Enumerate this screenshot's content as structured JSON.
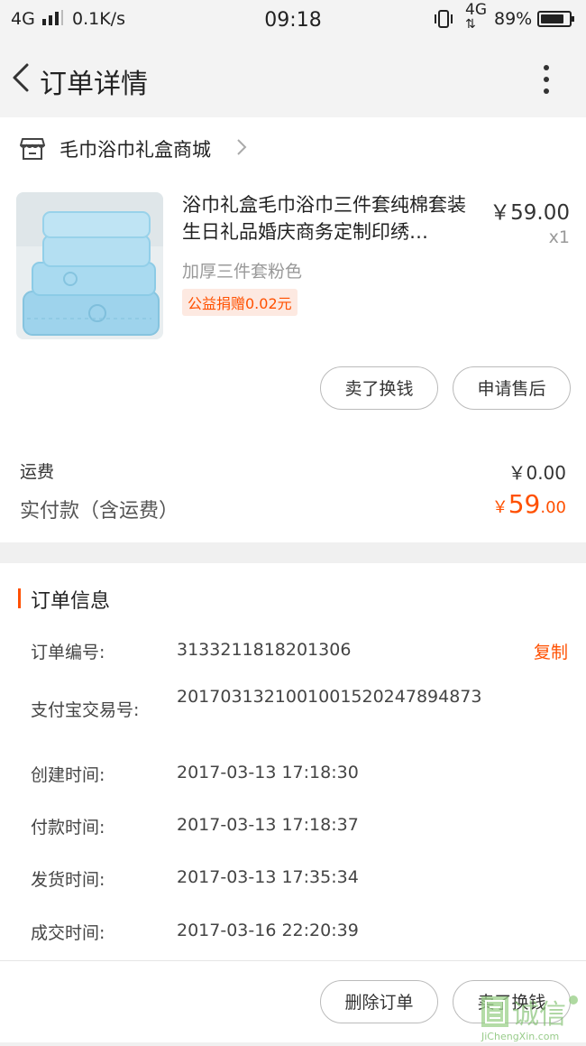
{
  "status_bar": {
    "signal": "4G",
    "net_speed": "0.1K/s",
    "time": "09:18",
    "lte": "4G",
    "battery_pct": "89%",
    "battery_level": 0.89
  },
  "header": {
    "title": "订单详情"
  },
  "shop": {
    "name": "毛巾浴巾礼盒商城"
  },
  "product": {
    "name": "浴巾礼盒毛巾浴巾三件套纯棉套装生日礼品婚庆商务定制印绣…",
    "price": "￥59.00",
    "qty": "x1",
    "spec": "加厚三件套粉色",
    "charity_tag": "公益捐赠0.02元"
  },
  "product_actions": {
    "sell": "卖了换钱",
    "after_sales": "申请售后"
  },
  "fees": {
    "shipping_label": "运费",
    "shipping_value": "￥0.00",
    "paid_label": "实付款（含运费）",
    "paid_symbol": "￥",
    "paid_int": "59",
    "paid_dec": ".00"
  },
  "order_info": {
    "heading": "订单信息",
    "copy_label": "复制",
    "rows": [
      {
        "label": "订单编号:",
        "value": "3133211818201306"
      },
      {
        "label": "支付宝交易号:",
        "value": "2017031321001001520247894873"
      },
      {
        "label": "创建时间:",
        "value": "2017-03-13 17:18:30"
      },
      {
        "label": "付款时间:",
        "value": "2017-03-13 17:18:37"
      },
      {
        "label": "发货时间:",
        "value": "2017-03-13 17:35:34"
      },
      {
        "label": "成交时间:",
        "value": "2017-03-16 22:20:39"
      }
    ]
  },
  "bottom_actions": {
    "delete": "删除订单",
    "sell": "卖了换钱"
  },
  "watermark": {
    "text": "诚信",
    "domain": "JiChengXin.com"
  },
  "colors": {
    "accent": "#ff5000",
    "background": "#f0f0f0",
    "card": "#ffffff"
  }
}
